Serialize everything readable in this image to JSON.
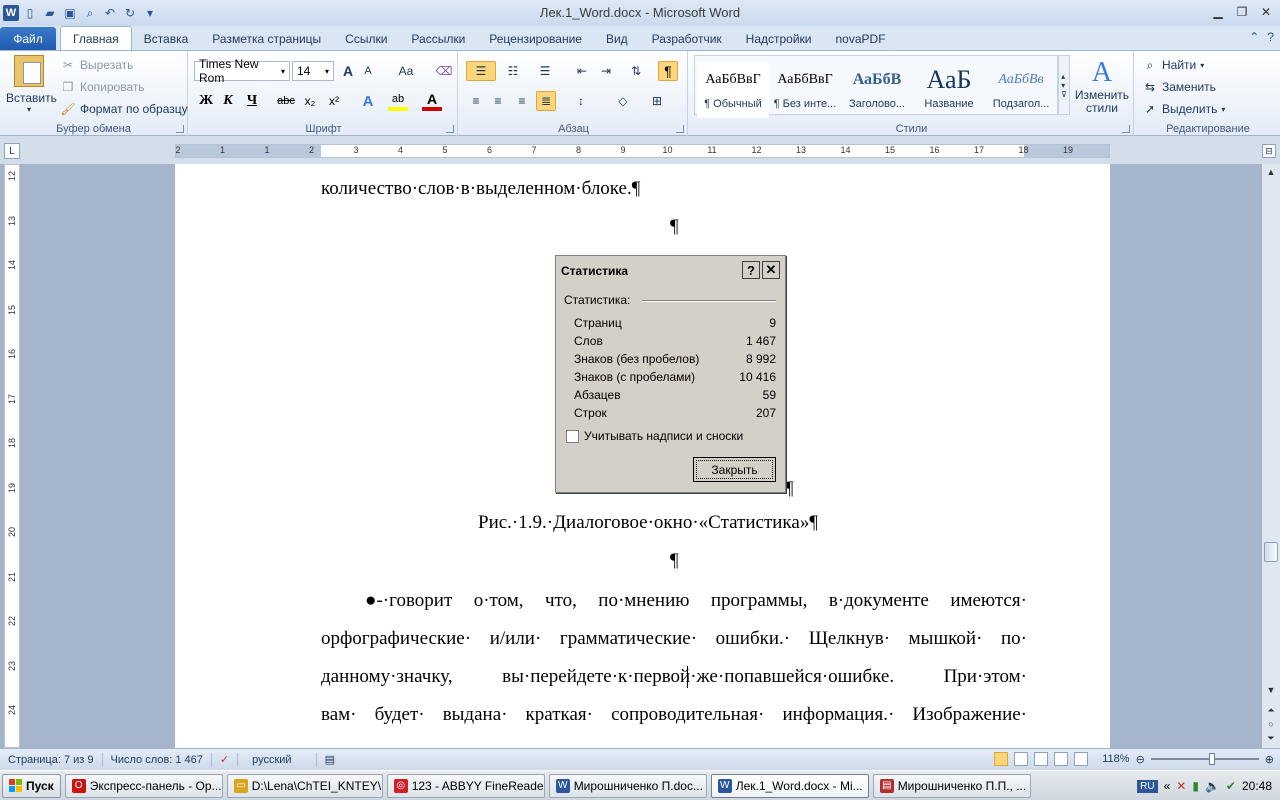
{
  "window": {
    "title": "Лек.1_Word.docx - Microsoft Word"
  },
  "tabs": {
    "file": "Файл",
    "items": [
      "Главная",
      "Вставка",
      "Разметка страницы",
      "Ссылки",
      "Рассылки",
      "Рецензирование",
      "Вид",
      "Разработчик",
      "Надстройки",
      "novaPDF"
    ]
  },
  "ribbon": {
    "clipboard": {
      "label": "Буфер обмена",
      "paste": "Вставить",
      "cut": "Вырезать",
      "copy": "Копировать",
      "format_painter": "Формат по образцу"
    },
    "font": {
      "label": "Шрифт",
      "font_name": "Times New Rom",
      "font_size": "14",
      "bold": "Ж",
      "italic": "К",
      "underline": "Ч",
      "strike": "abc",
      "subscript": "x₂",
      "superscript": "x²",
      "grow": "A",
      "shrink": "A",
      "case": "Aa"
    },
    "paragraph": {
      "label": "Абзац",
      "pilcrow": "¶"
    },
    "styles": {
      "label": "Стили",
      "items": [
        {
          "sample": "АаБбВвГ",
          "name": "¶ Обычный"
        },
        {
          "sample": "АаБбВвГ",
          "name": "¶ Без инте..."
        },
        {
          "sample": "АаБбВ",
          "name": "Заголово..."
        },
        {
          "sample": "АаБ",
          "name": "Название"
        },
        {
          "sample": "АаБбВв",
          "name": "Подзагол..."
        }
      ],
      "change": "Изменить стили"
    },
    "editing": {
      "label": "Редактирование",
      "find": "Найти",
      "replace": "Заменить",
      "select": "Выделить"
    }
  },
  "ruler": {
    "h_numbers": [
      "2",
      "1",
      "1",
      "2",
      "3",
      "4",
      "5",
      "6",
      "7",
      "8",
      "9",
      "10",
      "11",
      "12",
      "13",
      "14",
      "15",
      "16",
      "17",
      "18",
      "19"
    ],
    "v_numbers": [
      "12",
      "13",
      "14",
      "15",
      "16",
      "17",
      "18",
      "19",
      "20",
      "21",
      "22",
      "23",
      "24"
    ]
  },
  "document": {
    "line_top": "количество·слов·в·выделенном·блоке.¶",
    "pilcrow": "¶",
    "caption": "Рис.·1.9.·Диалоговое·окно·«Статистика»¶",
    "para_lines": [
      [
        "●-·говорит",
        "о·том,",
        "что,",
        "по·мнению",
        "программы,",
        "в·документе",
        "имеются·"
      ],
      [
        "орфографические·",
        "и/или·",
        "грамматические·",
        "ошибки.·",
        "Щелкнув·",
        "мышкой·",
        "по·"
      ],
      [
        "данному·значку,",
        "вы·перейдете·к·первой·же·попавшейся·ошибке.",
        "При·этом·"
      ],
      [
        "вам·",
        "будет·",
        "выдана·",
        "краткая·",
        "сопроводительная·",
        "информация.·",
        "Изображение·"
      ]
    ]
  },
  "dialog": {
    "title": "Статистика",
    "help": "?",
    "close_x": "✕",
    "group": "Статистика:",
    "rows": [
      {
        "label": "Страниц",
        "value": "9"
      },
      {
        "label": "Слов",
        "value": "1 467"
      },
      {
        "label": "Знаков (без пробелов)",
        "value": "8 992"
      },
      {
        "label": "Знаков (с пробелами)",
        "value": "10 416"
      },
      {
        "label": "Абзацев",
        "value": "59"
      },
      {
        "label": "Строк",
        "value": "207"
      }
    ],
    "checkbox_label": "Учитывать надписи и сноски",
    "close_button": "Закрыть"
  },
  "statusbar": {
    "page": "Страница: 7 из 9",
    "words": "Число слов: 1 467",
    "language": "русский",
    "zoom": "118%"
  },
  "taskbar": {
    "start": "Пуск",
    "tasks": [
      {
        "label": "Экспресс-панель - Op...",
        "color": "#cc1111"
      },
      {
        "label": "D:\\Lena\\ChTEI_KNTEY\\...",
        "color": "#d9a520"
      },
      {
        "label": "123 - ABBYY FineReade...",
        "color": "#d01f2a"
      },
      {
        "label": "Мирошниченко П.doc...",
        "color": "#2b579a"
      },
      {
        "label": "Лек.1_Word.docx - Mi...",
        "color": "#2b579a"
      },
      {
        "label": "Мирошниченко П.П., ...",
        "color": "#b03030"
      }
    ],
    "lang": "RU",
    "clock": "20:48"
  }
}
